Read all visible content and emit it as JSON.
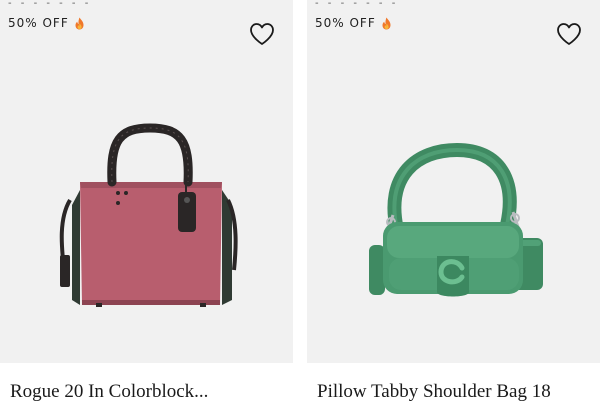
{
  "products": [
    {
      "badge_text": "50% OFF",
      "badge_icon": "fire-icon",
      "wishlist_icon": "heart-icon",
      "title": "Rogue 20 In Colorblock...",
      "top_dashes": "- - - - - - -",
      "colors": {
        "bag": "#b85e6e",
        "strap": "#2a2626",
        "side": "#2f3a33"
      }
    },
    {
      "badge_text": "50% OFF",
      "badge_icon": "fire-icon",
      "wishlist_icon": "heart-icon",
      "title": "Pillow Tabby Shoulder Bag 18",
      "top_dashes": "- - - - - - -",
      "colors": {
        "bag": "#4a9a70",
        "hardware": "#b9bcc0"
      }
    }
  ]
}
